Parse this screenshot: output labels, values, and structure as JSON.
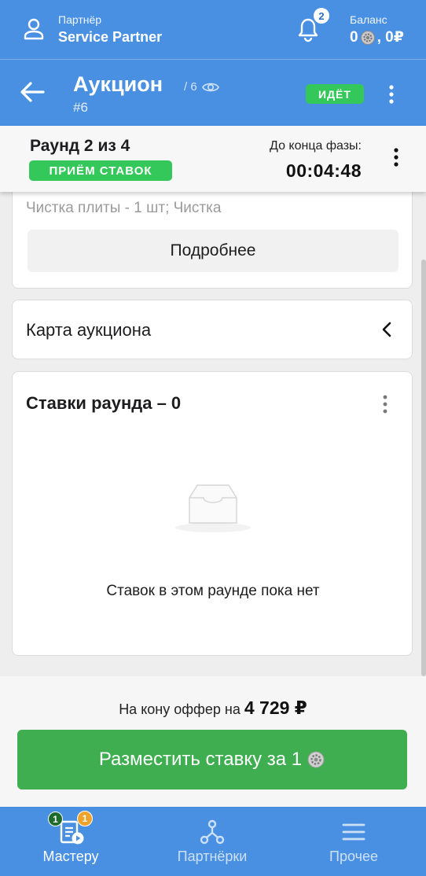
{
  "topbar": {
    "partner_label": "Партнёр",
    "partner_name": "Service Partner",
    "notifications_count": "2",
    "balance_label": "Баланс",
    "balance_coins": "0",
    "balance_money": ", 0₽"
  },
  "header": {
    "title": "Аукцион",
    "views": "/ 6",
    "number": "#6",
    "status": "ИДЁТ"
  },
  "round": {
    "title": "Раунд 2 из 4",
    "phase": "ПРИЁМ СТАВОК",
    "phase_end_label": "До конца фазы:",
    "timer": "00:04:48"
  },
  "details_card": {
    "faded_line": "Чистка плиты - 1 шт; Чистка",
    "more_button": "Подробнее"
  },
  "auction_map": {
    "title": "Карта аукциона"
  },
  "bids": {
    "title": "Ставки раунда – 0",
    "empty_text": "Ставок в этом раунде пока нет"
  },
  "action": {
    "offer_text": "На кону оффер на",
    "offer_amount": "4 729 ₽",
    "bid_button": "Разместить ставку за 1"
  },
  "tabbar": {
    "tabs": [
      {
        "label": "Мастеру",
        "badge_green": "1",
        "badge_orange": "1"
      },
      {
        "label": "Партнёрки"
      },
      {
        "label": "Прочее"
      }
    ]
  },
  "colors": {
    "primary": "#4a90e2",
    "success": "#34c759",
    "button_green": "#3fae50",
    "badge_orange": "#f0a32b"
  }
}
